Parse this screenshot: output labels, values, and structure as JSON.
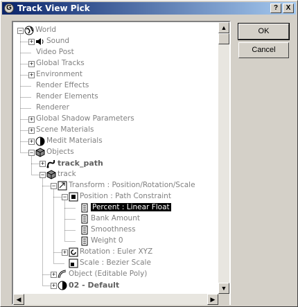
{
  "window": {
    "title": "Track View Pick",
    "help_glyph": "?",
    "close_glyph": "X",
    "app_glyph": "G"
  },
  "buttons": {
    "ok": "OK",
    "cancel": "Cancel"
  },
  "tree": [
    {
      "label": "World",
      "depth": 0,
      "expander": "minus",
      "icon": "globe-icon",
      "style": "normal"
    },
    {
      "label": "Sound",
      "depth": 1,
      "expander": "plus",
      "icon": "speaker-icon",
      "style": "normal"
    },
    {
      "label": "Video Post",
      "depth": 1,
      "expander": "none",
      "icon": "",
      "style": "normal"
    },
    {
      "label": "Global Tracks",
      "depth": 1,
      "expander": "plus",
      "icon": "",
      "style": "normal"
    },
    {
      "label": "Environment",
      "depth": 1,
      "expander": "plus",
      "icon": "",
      "style": "normal"
    },
    {
      "label": "Render Effects",
      "depth": 1,
      "expander": "none",
      "icon": "",
      "style": "normal"
    },
    {
      "label": "Render Elements",
      "depth": 1,
      "expander": "none",
      "icon": "",
      "style": "normal"
    },
    {
      "label": "Renderer",
      "depth": 1,
      "expander": "none",
      "icon": "",
      "style": "normal"
    },
    {
      "label": "Global Shadow Parameters",
      "depth": 1,
      "expander": "plus",
      "icon": "",
      "style": "normal"
    },
    {
      "label": "Scene Materials",
      "depth": 1,
      "expander": "plus",
      "icon": "",
      "style": "normal"
    },
    {
      "label": "Medit Materials",
      "depth": 1,
      "expander": "plus",
      "icon": "material-sphere-icon",
      "style": "normal"
    },
    {
      "label": "Objects",
      "depth": 1,
      "expander": "minus",
      "icon": "cube-icon",
      "style": "normal"
    },
    {
      "label": "track_path",
      "depth": 2,
      "expander": "plus",
      "icon": "spline-icon",
      "style": "bold"
    },
    {
      "label": "track",
      "depth": 2,
      "expander": "minus",
      "icon": "cube-icon",
      "style": "normal"
    },
    {
      "label": "Transform : Position/Rotation/Scale",
      "depth": 3,
      "expander": "minus",
      "icon": "transform-icon",
      "style": "normal"
    },
    {
      "label": "Position : Path Constraint",
      "depth": 4,
      "expander": "minus",
      "icon": "position-icon",
      "style": "normal"
    },
    {
      "label": "Percent : Linear Float",
      "depth": 5,
      "expander": "none",
      "icon": "float-track-icon",
      "style": "selected"
    },
    {
      "label": "Bank Amount",
      "depth": 5,
      "expander": "none",
      "icon": "float-track-icon",
      "style": "normal"
    },
    {
      "label": "Smoothness",
      "depth": 5,
      "expander": "none",
      "icon": "float-track-icon",
      "style": "normal"
    },
    {
      "label": "Weight 0",
      "depth": 5,
      "expander": "none",
      "icon": "float-track-icon",
      "style": "normal"
    },
    {
      "label": "Rotation : Euler XYZ",
      "depth": 4,
      "expander": "plus",
      "icon": "rotation-icon",
      "style": "normal"
    },
    {
      "label": "Scale : Bezier Scale",
      "depth": 4,
      "expander": "none",
      "icon": "scale-icon",
      "style": "normal"
    },
    {
      "label": "Object (Editable Poly)",
      "depth": 3,
      "expander": "plus",
      "icon": "poly-object-icon",
      "style": "normal"
    },
    {
      "label": "02 - Default",
      "depth": 3,
      "expander": "plus",
      "icon": "material-sphere-icon",
      "style": "bold"
    }
  ]
}
